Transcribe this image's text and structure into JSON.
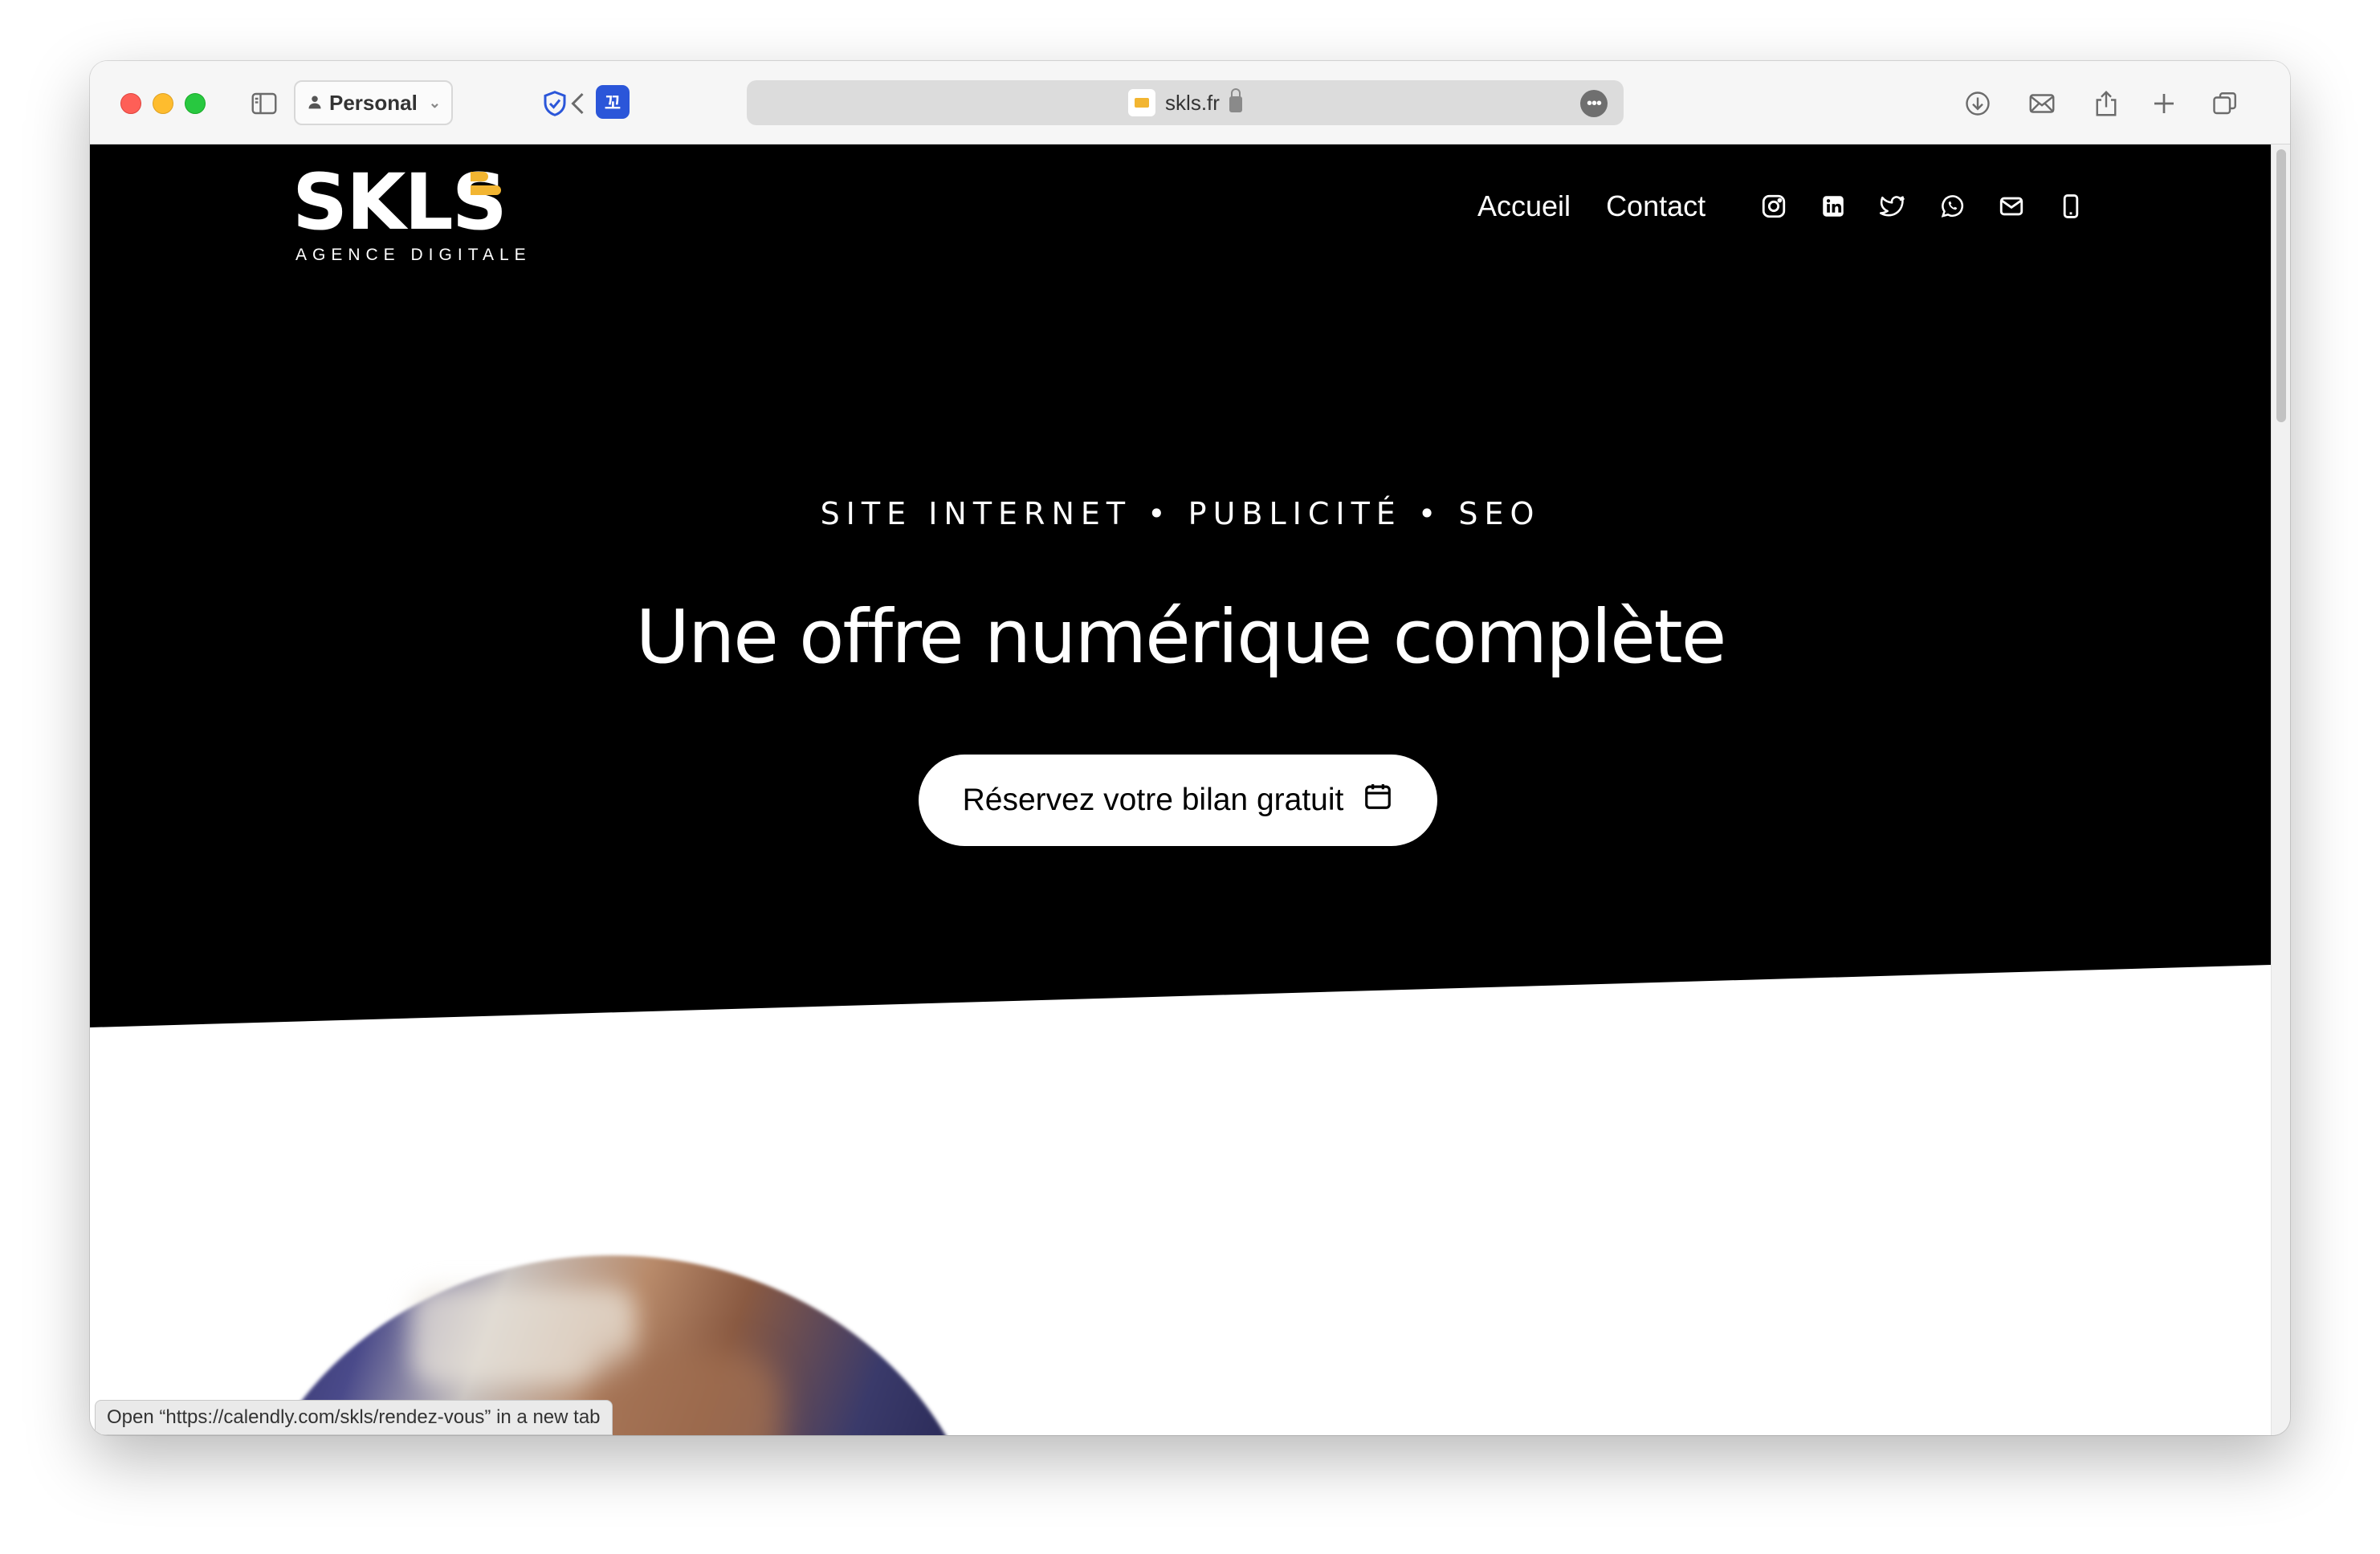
{
  "browser": {
    "profile_label": "Personal",
    "url_text": "skls.fr",
    "extension_badge": "꼬",
    "status_text": "Open “https://calendly.com/skls/rendez-vous” in a new tab"
  },
  "site": {
    "logo_text": "SKLS",
    "logo_subtitle": "AGENCE DIGITALE",
    "nav": [
      "Accueil",
      "Contact"
    ],
    "tagline": "SITE INTERNET • PUBLICITÉ • SEO",
    "headline": "Une offre numérique complète",
    "cta_label": "Réservez votre bilan gratuit"
  },
  "colors": {
    "hero_bg": "#000000",
    "brand_accent": "#f2b531",
    "cta_bg": "#ffffff"
  },
  "icons": [
    "sidebar-icon",
    "back-icon",
    "shield-icon",
    "download-icon",
    "mail-icon",
    "share-icon",
    "plus-icon",
    "tabs-icon",
    "instagram-icon",
    "linkedin-icon",
    "twitter-icon",
    "whatsapp-icon",
    "email-icon",
    "phone-icon",
    "calendar-icon"
  ]
}
